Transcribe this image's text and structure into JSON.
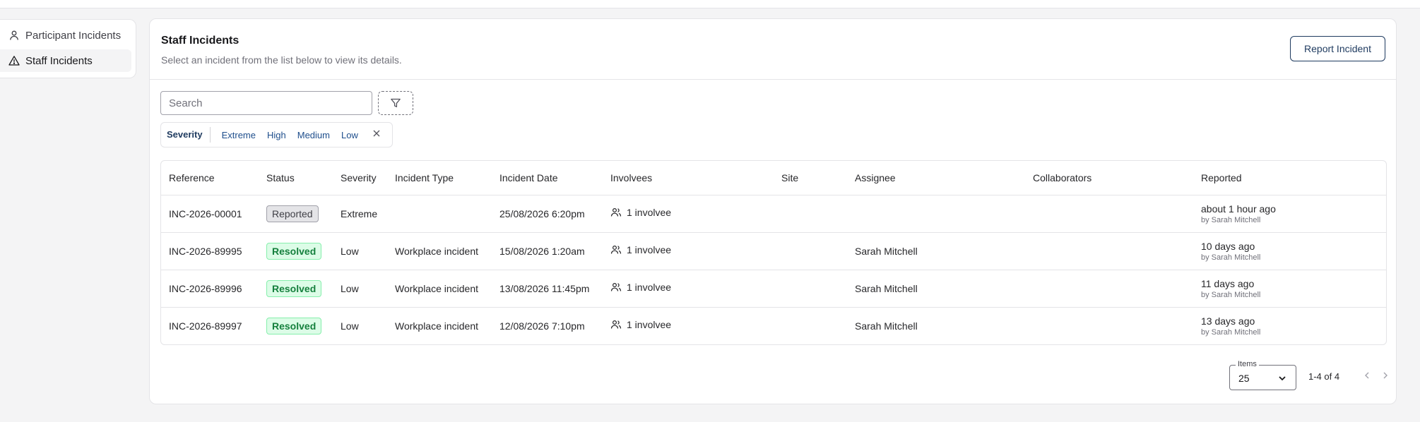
{
  "sidebar": {
    "items": [
      {
        "label": "Participant Incidents",
        "icon": "person-icon"
      },
      {
        "label": "Staff Incidents",
        "icon": "warning-triangle-icon"
      }
    ]
  },
  "header": {
    "title": "Staff Incidents",
    "subtitle": "Select an incident from the list below to view its details.",
    "report_button": "Report Incident"
  },
  "search": {
    "placeholder": "Search"
  },
  "filter_chips": {
    "label": "Severity",
    "options": [
      "Extreme",
      "High",
      "Medium",
      "Low"
    ]
  },
  "table": {
    "columns": [
      "Reference",
      "Status",
      "Severity",
      "Incident Type",
      "Incident Date",
      "Involvees",
      "Site",
      "Assignee",
      "Collaborators",
      "Reported"
    ],
    "rows": [
      {
        "reference": "INC-2026-00001",
        "status": "Reported",
        "severity": "Extreme",
        "type": "",
        "date": "25/08/2026 6:20pm",
        "involvees": "1 involvee",
        "site": "",
        "assignee": "",
        "collaborators": "",
        "reported": "about 1 hour ago",
        "reported_by": "by Sarah Mitchell"
      },
      {
        "reference": "INC-2026-89995",
        "status": "Resolved",
        "severity": "Low",
        "type": "Workplace incident",
        "date": "15/08/2026 1:20am",
        "involvees": "1 involvee",
        "site": "",
        "assignee": "Sarah Mitchell",
        "collaborators": "",
        "reported": "10 days ago",
        "reported_by": "by Sarah Mitchell"
      },
      {
        "reference": "INC-2026-89996",
        "status": "Resolved",
        "severity": "Low",
        "type": "Workplace incident",
        "date": "13/08/2026 11:45pm",
        "involvees": "1 involvee",
        "site": "",
        "assignee": "Sarah Mitchell",
        "collaborators": "",
        "reported": "11 days ago",
        "reported_by": "by Sarah Mitchell"
      },
      {
        "reference": "INC-2026-89997",
        "status": "Resolved",
        "severity": "Low",
        "type": "Workplace incident",
        "date": "12/08/2026 7:10pm",
        "involvees": "1 involvee",
        "site": "",
        "assignee": "Sarah Mitchell",
        "collaborators": "",
        "reported": "13 days ago",
        "reported_by": "by Sarah Mitchell"
      }
    ]
  },
  "pagination": {
    "items_label": "Items",
    "items_value": "25",
    "range": "1-4 of 4"
  },
  "colors": {
    "accent": "#1e3a5f",
    "resolved_bg": "#dcfce7",
    "resolved_text": "#15803d",
    "reported_bg": "#e4e4e7"
  }
}
